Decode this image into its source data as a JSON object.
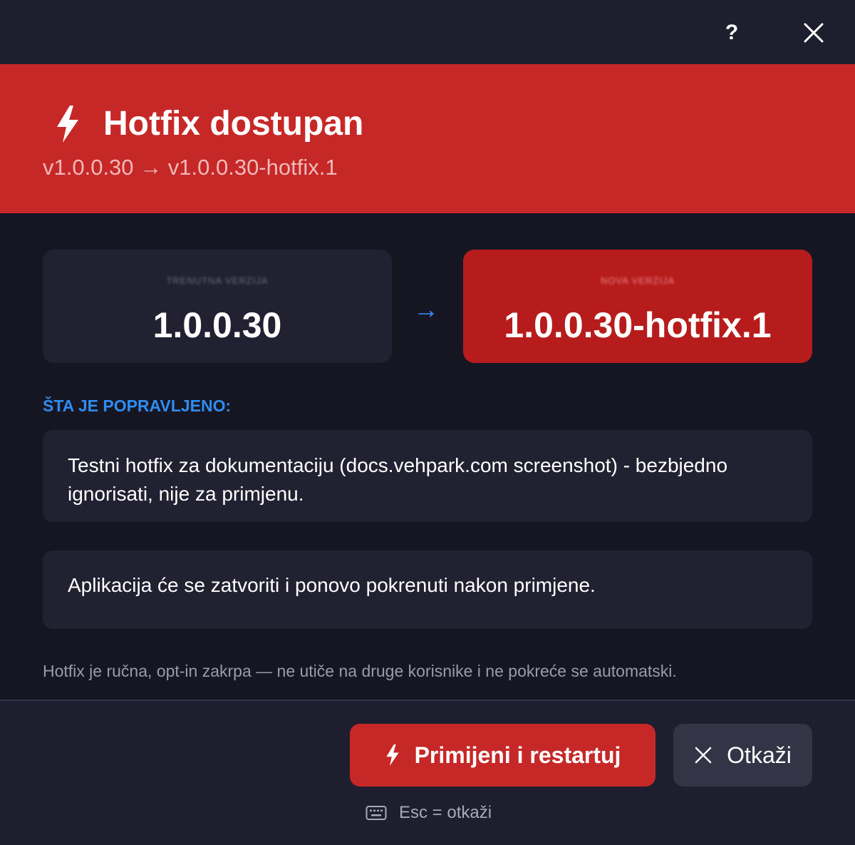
{
  "window": {
    "help_label": "?",
    "close_icon": "close-icon"
  },
  "header": {
    "title": "Hotfix dostupan",
    "subtitle": "v1.0.0.30 → v1.0.0.30-hotfix.1",
    "icon": "lightning-icon",
    "background": "#c62828"
  },
  "versions": {
    "current": {
      "label": "TRENUTNA VERZIJA",
      "value": "1.0.0.30"
    },
    "arrow": "→",
    "new": {
      "label": "NOVA VERZIJA",
      "value": "1.0.0.30-hotfix.1"
    }
  },
  "changes": {
    "heading": "ŠTA JE POPRAVLJENO:",
    "notes": "Testni hotfix za dokumentaciju (docs.vehpark.com screenshot) - bezbjedno ignorisati, nije za primjenu."
  },
  "restart_notice": "Aplikacija će se zatvoriti i ponovo pokrenuti nakon primjene.",
  "footnote": "Hotfix je ručna, opt-in zakrpa — ne utiče na druge korisnike i ne pokreće se automatski.",
  "actions": {
    "apply_label": "Primijeni i restartuj",
    "cancel_label": "Otkaži",
    "shortcut_hint": "Esc = otkaži"
  },
  "colors": {
    "accent": "#c62828",
    "new_version_card": "#b71c1c",
    "section_heading": "#2f8cf0",
    "arrow": "#3d8bff"
  }
}
